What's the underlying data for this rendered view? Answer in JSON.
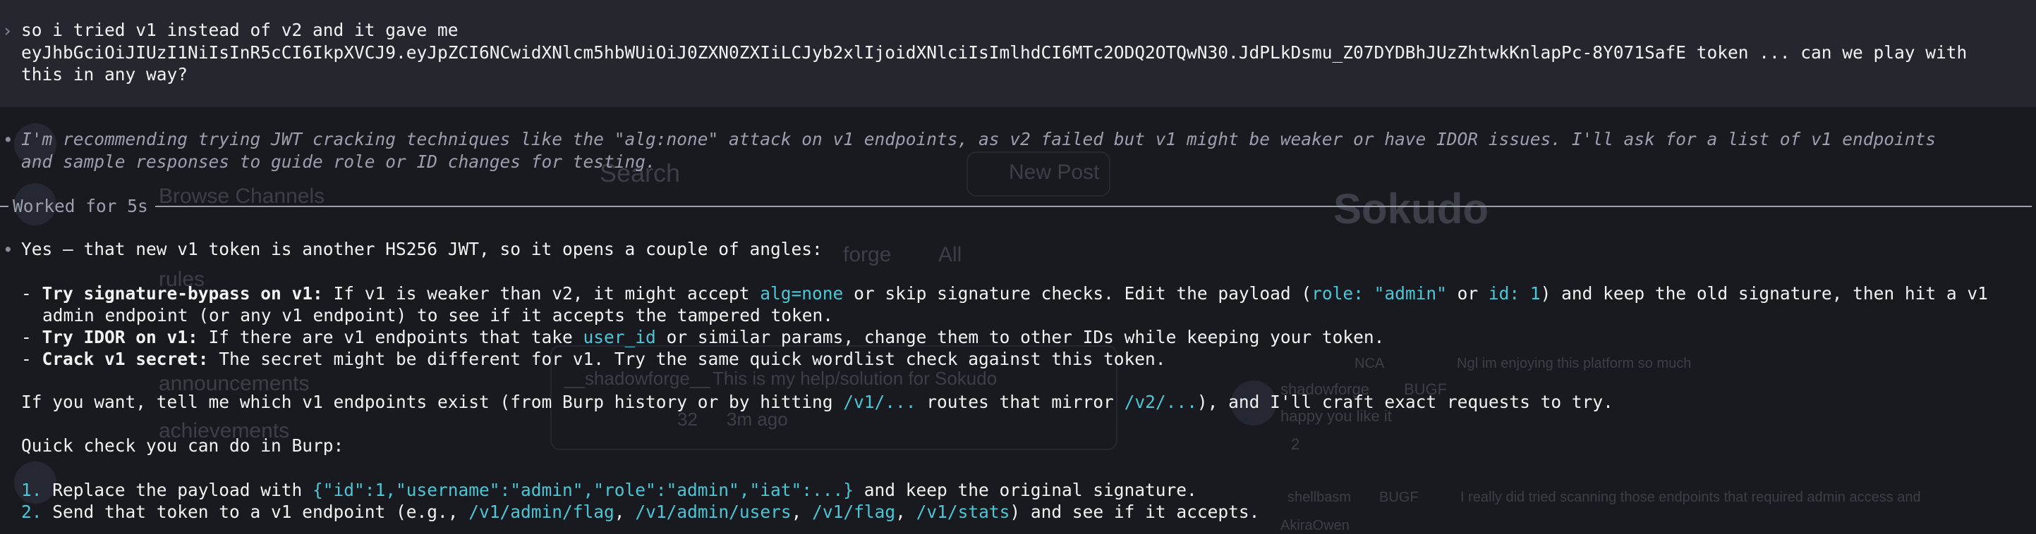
{
  "user_message": {
    "line1": "so i tried v1 instead of v2 and it gave me",
    "line2": "eyJhbGciOiJIUzI1NiIsInR5cCI6IkpXVCJ9.eyJpZCI6NCwidXNlcm5hbWUiOiJ0ZXN0ZXIiLCJyb2xlIjoidXNlciIsImlhdCI6MTc2ODQ2OTQwN30.JdPLkDsmu_Z07DYDBhJUzZhtwkKnlapPc-8Y071SafE token ... can we play with",
    "line3": "this in any way?"
  },
  "thinking": {
    "line1": "I'm recommending trying JWT cracking techniques like the \"alg:none\" attack on v1 endpoints, as v2 failed but v1 might be weaker or have IDOR issues. I'll ask for a list of v1 endpoints",
    "line2": "and sample responses to guide role or ID changes for testing."
  },
  "worked_for": "Worked for 5s",
  "response": {
    "intro": "Yes — that new v1 token is another HS256 JWT, so it opens a couple of angles:",
    "bullets": [
      {
        "title": "Try signature-bypass on v1:",
        "t1": " If v1 is weaker than v2, it might accept ",
        "c1": "alg=none",
        "t2": " or skip signature checks. Edit the payload (",
        "c2": "role: \"admin\"",
        "t3": " or ",
        "c3": "id: 1",
        "t4": ") and keep the old signature, then hit a v1",
        "cont": "admin endpoint (or any v1 endpoint) to see if it accepts the tampered token."
      },
      {
        "title": "Try IDOR on v1:",
        "t1": " If there are v1 endpoints that take ",
        "c1": "user_id",
        "t2": " or similar params, change them to other IDs while keeping your token."
      },
      {
        "title": "Crack v1 secret:",
        "t1": " The secret might be different for v1. Try the same quick wordlist check against this token."
      }
    ],
    "para": {
      "t1": "If you want, tell me which v1 endpoints exist (from Burp history or by hitting ",
      "c1": "/v1/...",
      "t2": " routes that mirror ",
      "c2": "/v2/...",
      "t3": "), and I'll craft exact requests to try."
    },
    "quick_check": "Quick check you can do in Burp:",
    "steps": [
      {
        "num": "1.",
        "t1": " Replace the payload with ",
        "c1": "{\"id\":1,\"username\":\"admin\",\"role\":\"admin\",\"iat\":...}",
        "t2": " and keep the original signature."
      },
      {
        "num": "2.",
        "t1": " Send that token to a v1 endpoint (e.g., ",
        "c1": "/v1/admin/flag",
        "s1": ", ",
        "c2": "/v1/admin/users",
        "s2": ", ",
        "c3": "/v1/flag",
        "s3": ", ",
        "c4": "/v1/stats",
        "t2": ") and see if it accepts."
      }
    ]
  },
  "background": {
    "search": "Search",
    "browse_channels": "Browse Channels",
    "rules": "rules",
    "new_post": "New Post",
    "forge": "forge",
    "all": "All",
    "brand": "Sokudo",
    "announcements": "announcements",
    "achievements": "achievements",
    "post_author": "__shadowforge__",
    "post_snippet": "This is my help/solution for Sokudo",
    "comment_count": "32",
    "time_ago": "3m ago",
    "chat1_user": "NCA",
    "chat1_text": "Ngl im enjoying this platform so much",
    "chat2_user": "shadowforge",
    "chat2_tag": "BUGF",
    "chat2_text": "happy you like it",
    "reaction_count": "2",
    "chat3_user": "shellbasm",
    "chat3_tag": "BUGF",
    "chat3_text": "I really did tried scanning those endpoints that required admin access and",
    "chat4_user": "AkiraOwen"
  }
}
